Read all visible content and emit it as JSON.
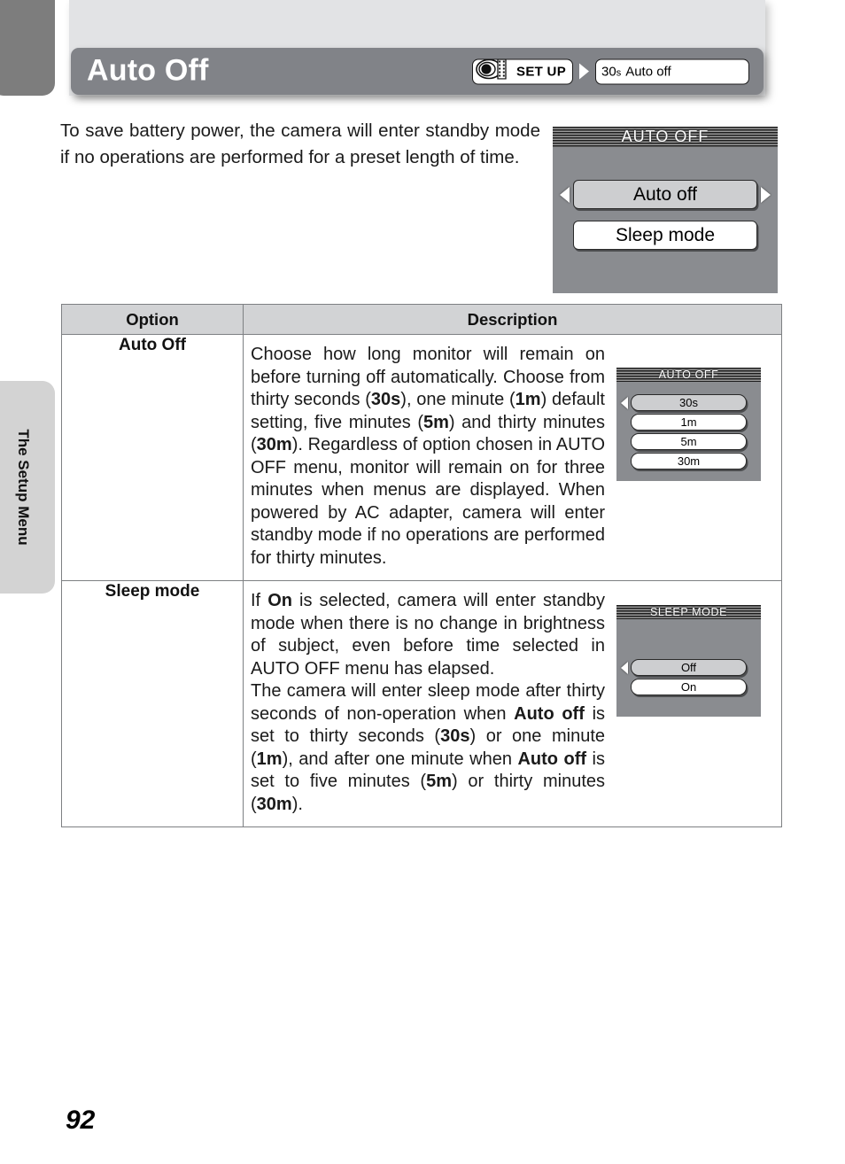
{
  "page": {
    "number": "92",
    "side_tab_label": "The Setup Menu"
  },
  "header": {
    "title": "Auto Off",
    "breadcrumb": {
      "setup_label": "SET UP",
      "camera_icon": "camera-film-icon",
      "arrow_icon": "chevron-right-icon",
      "value_number": "30",
      "value_unit": "s",
      "value_text": "Auto off"
    }
  },
  "intro": {
    "text": "To save battery power, the camera will enter standby mode if no operations are performed for a preset length of time."
  },
  "lcd_main": {
    "title": "AUTO OFF",
    "arrow_left_icon": "triangle-left-icon",
    "arrow_right_icon": "triangle-right-icon",
    "options": [
      {
        "label": "Auto off",
        "selected": true
      },
      {
        "label": "Sleep mode",
        "selected": false
      }
    ]
  },
  "table": {
    "headers": {
      "option": "Option",
      "description": "Description"
    },
    "rows": [
      {
        "option": "Auto Off",
        "paragraphs": [
          "Choose how long monitor will remain on before turning off automatically. Choose from thirty seconds (<b>30s</b>), one minute (<b>1m</b>) default setting, five minutes (<b>5m</b>) and thirty minutes (<b>30m</b>). Regardless of option chosen in AUTO OFF menu, monitor will remain on for three minutes when menus are displayed. When powered by AC adapter, camera will enter standby mode if no operations are performed for thirty minutes."
        ],
        "lcd": {
          "title": "AUTO OFF",
          "arrow_left_icon": "triangle-left-icon",
          "options": [
            {
              "label": "30s",
              "selected": true
            },
            {
              "label": "1m",
              "selected": false
            },
            {
              "label": "5m",
              "selected": false
            },
            {
              "label": "30m",
              "selected": false
            }
          ]
        }
      },
      {
        "option": "Sleep mode",
        "paragraphs": [
          "If <b>On</b> is selected, camera will enter standby mode when there is no change in brightness of subject, even before time selected in AUTO OFF menu has elapsed.",
          "The camera will enter sleep mode after thirty seconds of non-operation when <b>Auto off</b> is set to thirty seconds (<b>30s</b>) or one minute (<b>1m</b>), and after one minute when <b>Auto off</b> is set to five minutes (<b>5m</b>) or thirty minutes (<b>30m</b>)."
        ],
        "lcd": {
          "title": "SLEEP MODE",
          "arrow_left_icon": "triangle-left-icon",
          "options": [
            {
              "label": "Off",
              "selected": true
            },
            {
              "label": "On",
              "selected": false
            }
          ]
        }
      }
    ]
  },
  "colors": {
    "header_bar": "#818388",
    "header_panel": "#e2e3e5",
    "corner_tab": "#7d7d7d",
    "side_tab": "#d3d3d3",
    "lcd_background": "#8a8c90",
    "lcd_selected": "#cdced0",
    "table_header": "#d2d3d5",
    "table_border": "#7e8083"
  }
}
